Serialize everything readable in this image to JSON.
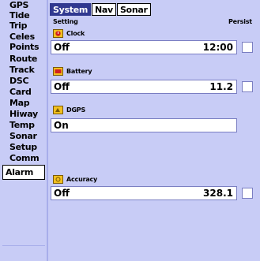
{
  "sidebar": {
    "items": [
      {
        "label": "GPS"
      },
      {
        "label": "Tide"
      },
      {
        "label": "Trip"
      },
      {
        "label": "Celes"
      },
      {
        "label": "Points"
      },
      {
        "label": "Route"
      },
      {
        "label": "Track"
      },
      {
        "label": "DSC"
      },
      {
        "label": "Card"
      },
      {
        "label": "Map"
      },
      {
        "label": "Hiway"
      },
      {
        "label": "Temp"
      },
      {
        "label": "Sonar"
      },
      {
        "label": "Setup"
      },
      {
        "label": "Comm"
      },
      {
        "label": "Alarm"
      }
    ],
    "active": "Alarm"
  },
  "tabs": [
    {
      "label": "System",
      "active": true
    },
    {
      "label": "Nav",
      "active": false
    },
    {
      "label": "Sonar",
      "active": false
    }
  ],
  "columns": {
    "setting": "Setting",
    "persist": "Persist"
  },
  "alarms": [
    {
      "label": "Clock",
      "icon": "alarm-clock-icon",
      "value": "Off",
      "detail": "12:00",
      "has_checkbox": true
    },
    {
      "label": "Battery",
      "icon": "battery-icon",
      "value": "Off",
      "detail": "11.2",
      "has_checkbox": true
    },
    {
      "label": "DGPS",
      "icon": "dgps-icon",
      "value": "On",
      "detail": "",
      "has_checkbox": false
    },
    {
      "label": "Accuracy",
      "icon": "accuracy-icon",
      "value": "Off",
      "detail": "328.1",
      "has_checkbox": true
    }
  ],
  "colors": {
    "background": "#c8ccf6",
    "tab_active": "#303890",
    "field_border": "#7a7ec2"
  }
}
